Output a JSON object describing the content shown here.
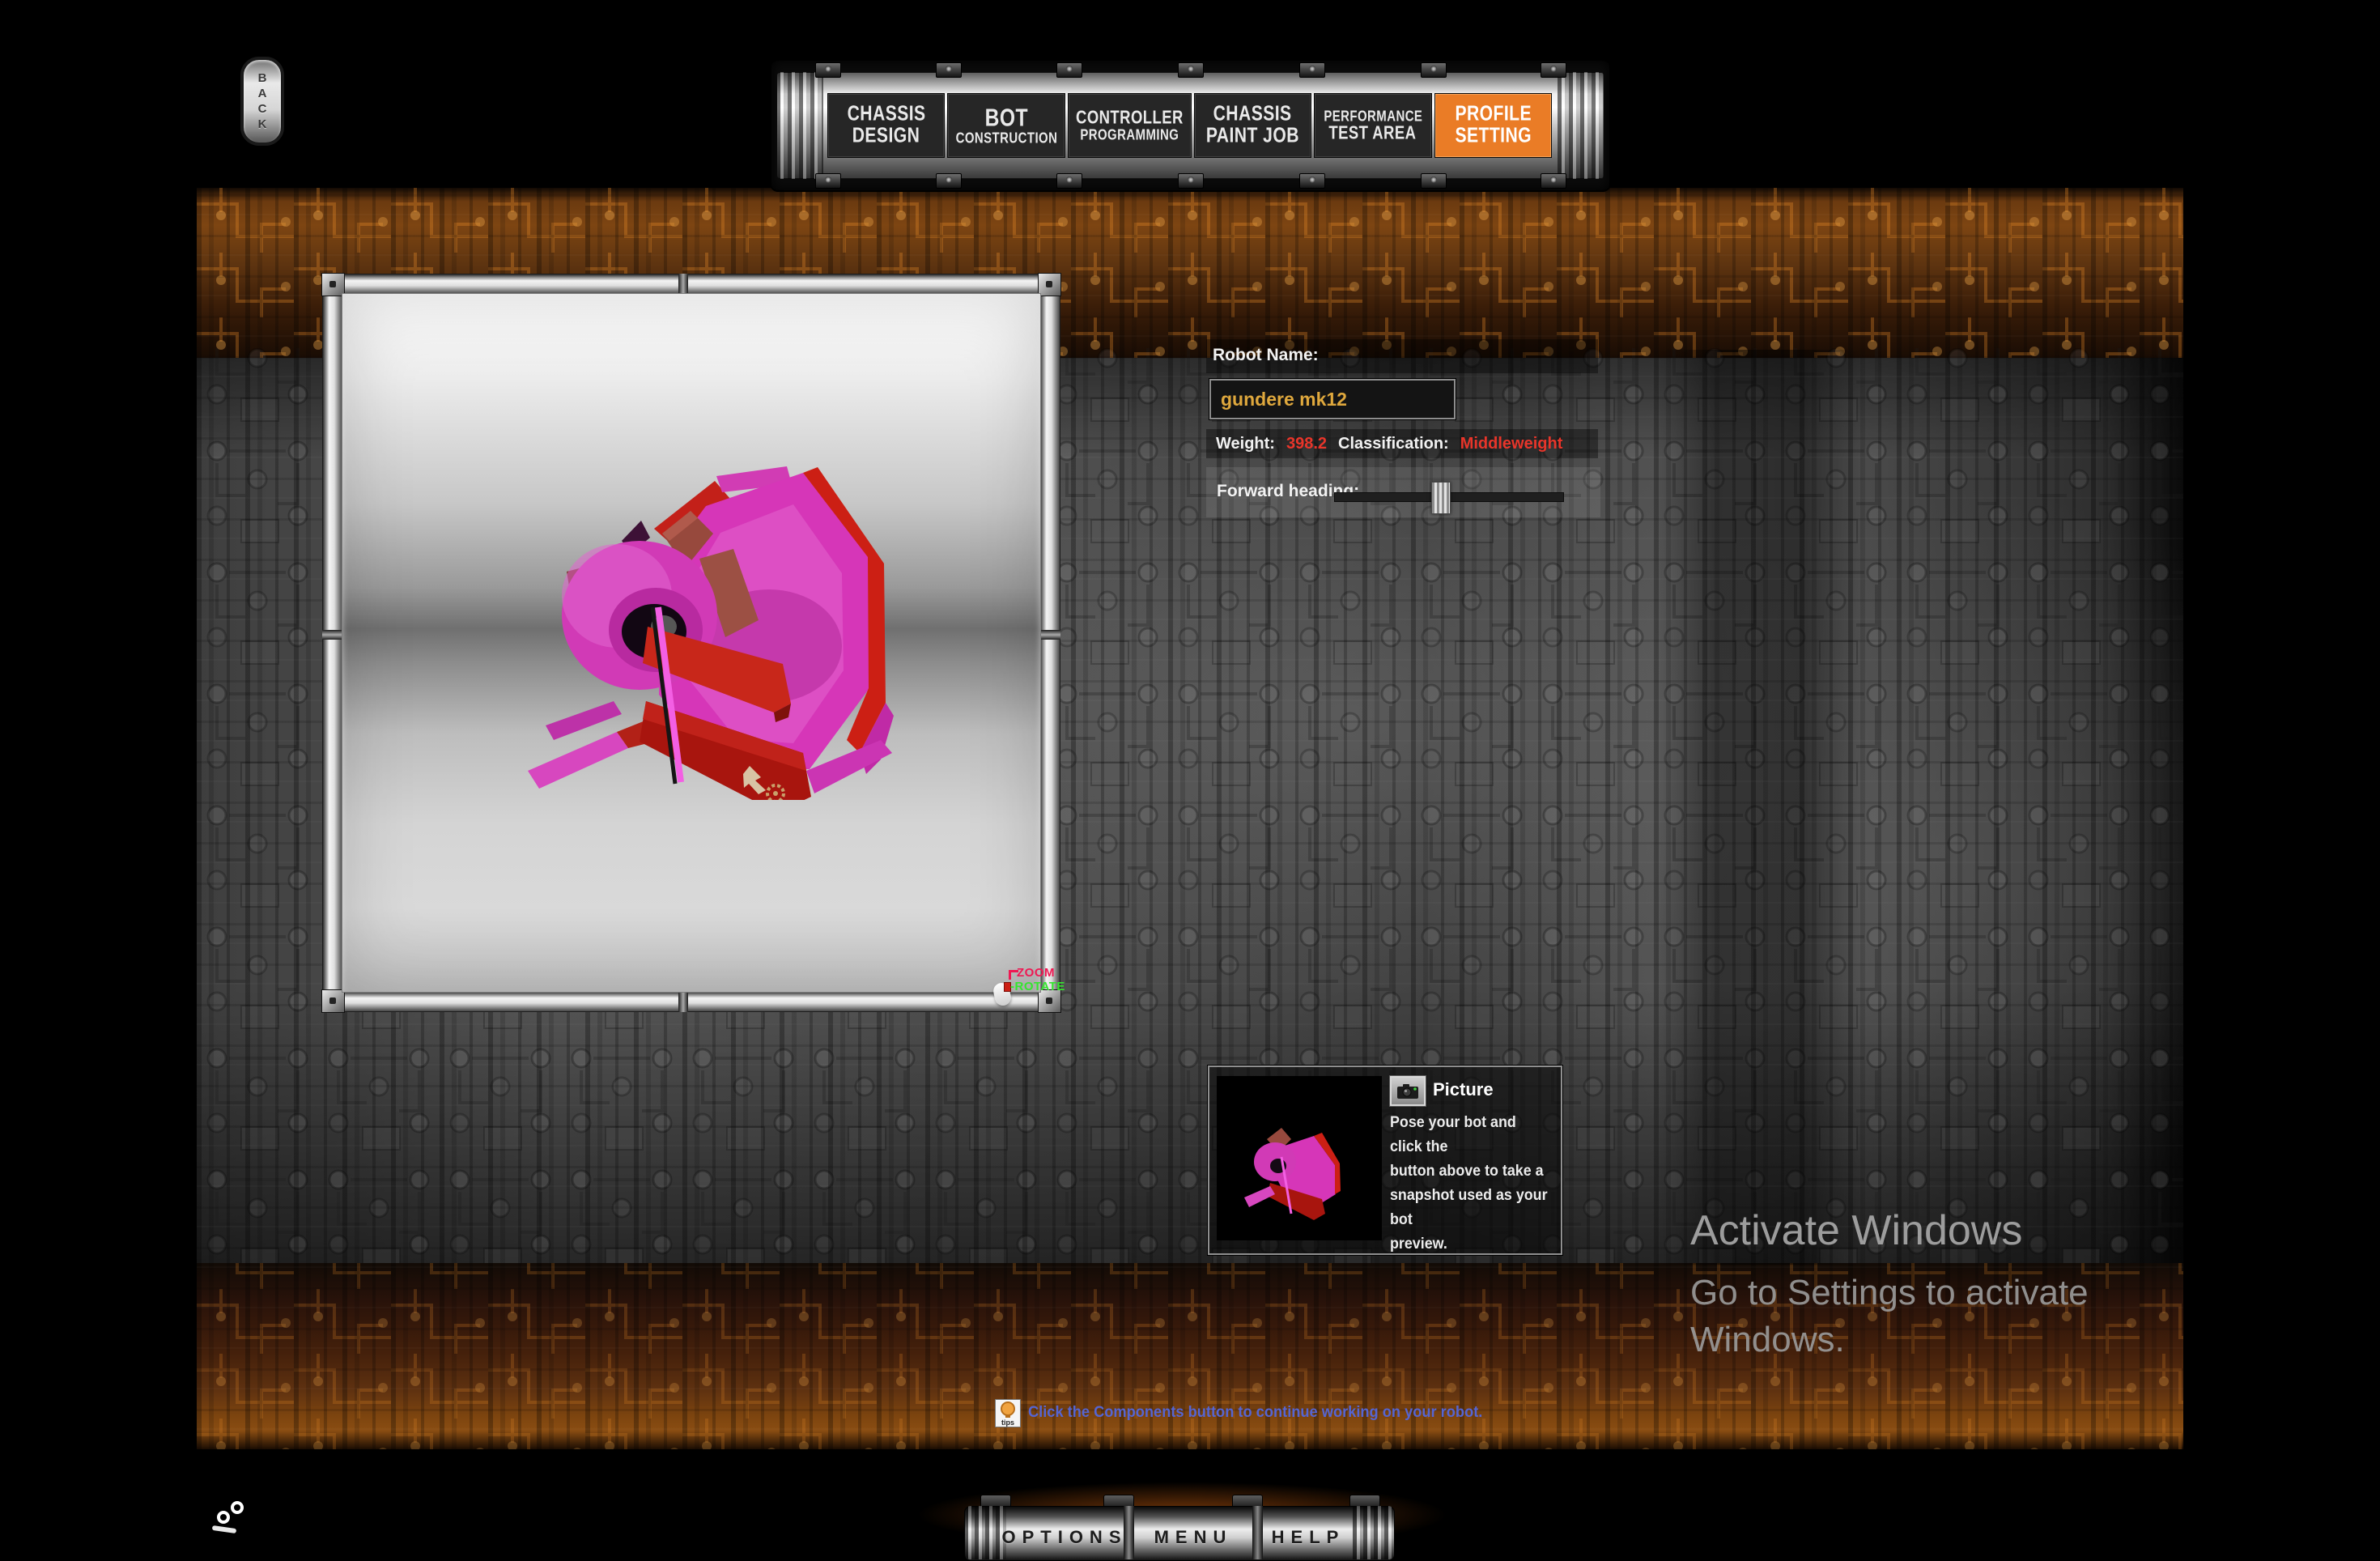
{
  "back_button": {
    "letters": [
      "B",
      "A",
      "C",
      "K"
    ]
  },
  "nav": {
    "active_tab": "PROFILE SETTING",
    "active_color": "#ea7c26",
    "tabs": [
      {
        "line1": "CHASSIS",
        "line2": "DESIGN"
      },
      {
        "line1": "BOT",
        "line2": "CONSTRUCTION"
      },
      {
        "line1": "CONTROLLER",
        "line2": "PROGRAMMING"
      },
      {
        "line1": "CHASSIS",
        "line2": "PAINT JOB"
      },
      {
        "line1": "PERFORMANCE",
        "line2": "TEST AREA"
      },
      {
        "line1": "PROFILE",
        "line2": "SETTING"
      }
    ]
  },
  "profile": {
    "robot_name_label": "Robot Name:",
    "robot_name_value": "gundere mk12",
    "name_value_color": "#dfa83d",
    "weight_label": "Weight:",
    "weight_value": "398.2",
    "classification_label": "Classification:",
    "classification_value": "Middleweight",
    "value_color": "#e8352a",
    "forward_heading_label": "Forward heading:"
  },
  "preview": {
    "zoom_hint": "ZOOM",
    "rotate_hint": "-ROTATE",
    "zoom_hint_color": "#ef1853",
    "rotate_hint_color": "#35e52f",
    "robot_color": "#d636b8"
  },
  "picture_panel": {
    "title": "Picture",
    "description_lines": [
      "Pose your bot and click the",
      "button above to take a",
      "snapshot used as your bot",
      "preview."
    ]
  },
  "tip": {
    "icon_label": "tips",
    "text": "Click the Components button to continue working on your robot.",
    "text_color": "#5565d2"
  },
  "watermark": {
    "line1": "Activate Windows",
    "line2": "Go to Settings to activate",
    "line3": "Windows."
  },
  "bottom_bar": {
    "buttons": [
      "OPTIONS",
      "MENU",
      "HELP"
    ]
  }
}
